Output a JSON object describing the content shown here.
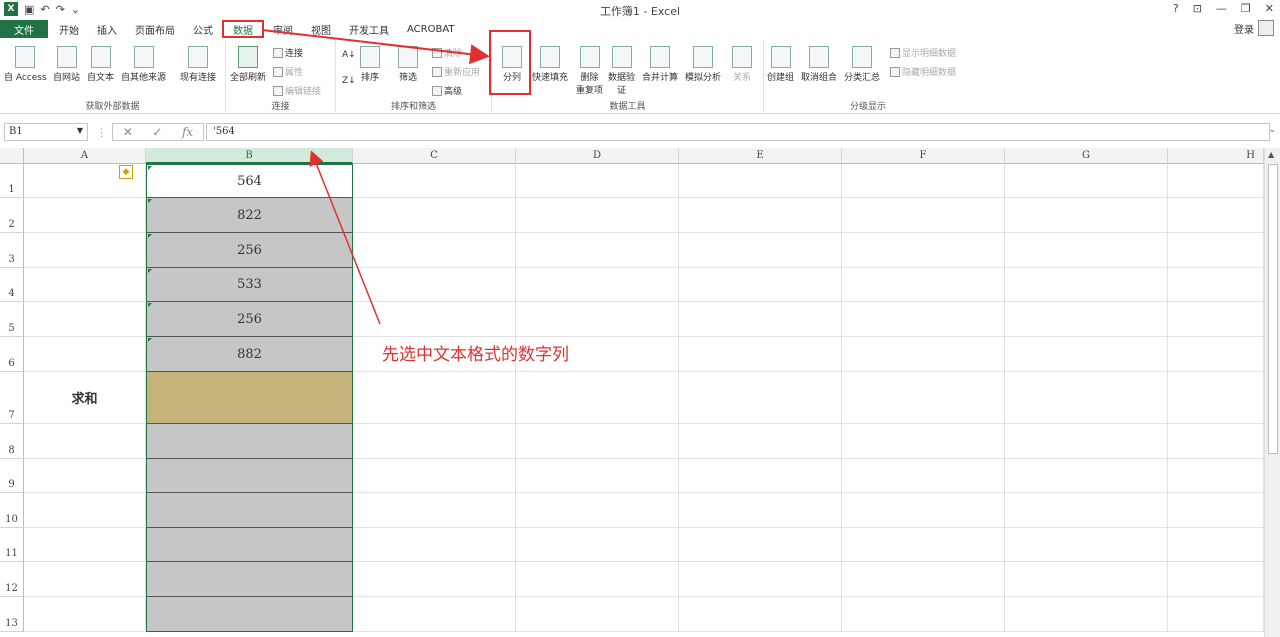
{
  "window": {
    "title": "工作簿1 - Excel",
    "help": "?",
    "ribbon_opts": "⊡",
    "minimize": "—",
    "restore": "❐",
    "close": "✕"
  },
  "qat": {
    "save": "▣",
    "undo": "↶",
    "redo": "↷",
    "more": "⌄"
  },
  "tabs": [
    "文件",
    "开始",
    "插入",
    "页面布局",
    "公式",
    "数据",
    "审阅",
    "视图",
    "开发工具",
    "ACROBAT"
  ],
  "active_tab": "数据",
  "account": {
    "login": "登录"
  },
  "ribbon": {
    "get_external": {
      "label": "获取外部数据",
      "buttons": [
        "自 Access",
        "自网站",
        "自文本",
        "自其他来源",
        "现有连接"
      ]
    },
    "connections": {
      "label": "连接",
      "refresh_all": "全部刷新",
      "connect": "连接",
      "props": "属性",
      "edit_links": "编辑链接"
    },
    "sort_filter": {
      "label": "排序和筛选",
      "sort": "排序",
      "filter": "筛选",
      "clear": "清除",
      "reapply": "重新应用",
      "advanced": "高级"
    },
    "data_tools": {
      "label": "数据工具",
      "buttons": [
        "分列",
        "快速填充",
        "删除\n重复项",
        "数据验\n证",
        "合并计算",
        "模拟分析",
        "关系"
      ]
    },
    "outline": {
      "label": "分级显示",
      "buttons": [
        "创建组",
        "取消组合",
        "分类汇总"
      ],
      "show_detail": "显示明细数据",
      "hide_detail": "隐藏明细数据"
    }
  },
  "formula_bar": {
    "name_box": "B1",
    "fx": "fx",
    "value": "'564",
    "cancel": "✕",
    "enter": "✓"
  },
  "columns": [
    "A",
    "B",
    "C",
    "D",
    "E",
    "F",
    "G",
    "H"
  ],
  "rows": [
    "1",
    "2",
    "3",
    "4",
    "5",
    "6",
    "7",
    "8",
    "9",
    "10",
    "11",
    "12",
    "13"
  ],
  "cells": {
    "B": [
      "564",
      "822",
      "256",
      "533",
      "256",
      "882"
    ],
    "A7": "求和"
  },
  "annotation": "先选中文本格式的数字列",
  "colors": {
    "accent": "#217346",
    "highlight": "#e03030",
    "sum_cell": "#c4b47a"
  }
}
